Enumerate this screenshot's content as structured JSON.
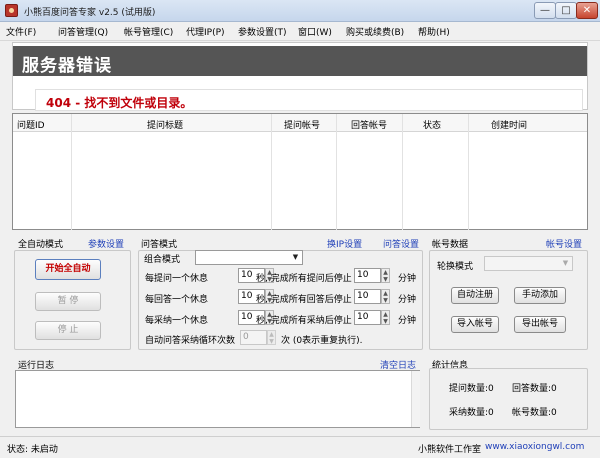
{
  "window": {
    "title": "小熊百度问答专家 v2.5 (试用版)",
    "min_glyph": "—",
    "max_glyph": "□",
    "close_glyph": "✕"
  },
  "menu": [
    "文件(F)",
    "问答管理(Q)",
    "帐号管理(C)",
    "代理IP(P)",
    "参数设置(T)",
    "窗口(W)",
    "购买或续费(B)",
    "帮助(H)"
  ],
  "web": {
    "error_title": "服务器错误",
    "error_message": "404 - 找不到文件或目录。"
  },
  "table": {
    "columns": [
      "问题ID",
      "提问标题",
      "提问帐号",
      "回答帐号",
      "状态",
      "创建时间"
    ],
    "rows": []
  },
  "auto_mode": {
    "title": "全自动模式",
    "settings_link": "参数设置",
    "start_button": "开始全自动",
    "pause_button": "暂 停",
    "stop_button": "停 止"
  },
  "qa_mode": {
    "title": "问答模式",
    "switch_ip_link": "换IP设置",
    "qa_settings_link": "问答设置",
    "combo_label": "组合模式",
    "combo_value": "",
    "rows": [
      {
        "prefix": "每提问一个休息",
        "rest_value": "10",
        "middle": "秒, 完成所有提问后停止",
        "stop_value": "10",
        "unit": "分钟"
      },
      {
        "prefix": "每回答一个休息",
        "rest_value": "10",
        "middle": "秒, 完成所有回答后停止",
        "stop_value": "10",
        "unit": "分钟"
      },
      {
        "prefix": "每采纳一个休息",
        "rest_value": "10",
        "middle": "秒, 完成所有采纳后停止",
        "stop_value": "10",
        "unit": "分钟"
      }
    ],
    "loop_label": "自动问答采纳循环次数",
    "loop_value": "0",
    "loop_hint": "次 (0表示重复执行)."
  },
  "account_data": {
    "title": "帐号数据",
    "settings_link": "帐号设置",
    "rotate_label": "轮换模式",
    "rotate_value": "",
    "auto_register": "自动注册",
    "manual_add": "手动添加",
    "import": "导入帐号",
    "export": "导出帐号"
  },
  "log": {
    "title": "运行日志",
    "clear_link": "清空日志"
  },
  "stats": {
    "title": "统计信息",
    "ask_label": "提问数量:",
    "ask_value": "0",
    "answer_label": "回答数量:",
    "answer_value": "0",
    "adopt_label": "采纳数量:",
    "adopt_value": "0",
    "account_label": "帐号数量:",
    "account_value": "0"
  },
  "status": {
    "state_label": "状态:",
    "state_value": "未启动",
    "studio": "小熊软件工作室",
    "website": "www.xiaoxiongwl.com"
  }
}
